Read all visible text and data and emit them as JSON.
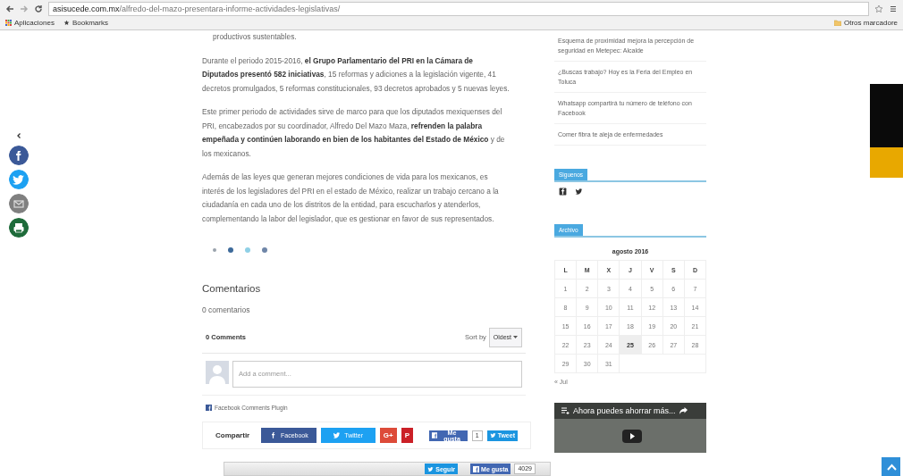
{
  "browser": {
    "url_host": "asisucede.com.mx",
    "url_path": "/alfredo-del-mazo-presentara-informe-actividades-legislativas/",
    "bookmarks": [
      {
        "kind": "apps",
        "label": "Aplicaciones"
      },
      {
        "kind": "star",
        "label": "Bookmarks"
      }
    ],
    "other_bookmarks": "Otros marcadore"
  },
  "share_rail": {
    "items": [
      {
        "kind": "facebook"
      },
      {
        "kind": "twitter"
      },
      {
        "kind": "email"
      },
      {
        "kind": "print"
      }
    ]
  },
  "article": {
    "paragraphs": [
      "productivos sustentables.",
      "Durante el periodo 2015-2016, **el Grupo Parlamentario del PRI en la Cámara de Diputados presentó 582 iniciativas**, 15 reformas y adiciones a la legislación vigente, 41 decretos promulgados, 5 reformas constitucionales, 93 decretos aprobados y 5 nuevas leyes.",
      "Este primer periodo de actividades sirve de marco para que los diputados mexiquenses del PRI, encabezados por su coordinador, Alfredo Del Mazo Maza, **refrenden la palabra empeñada y continúen laborando en bien de los habitantes del Estado de México** y de los mexicanos.",
      "Además de las leyes que generan mejores condiciones de vida para los mexicanos, es interés de los legisladores del PRI en el estado de México, realizar un trabajo cercano a la ciudadanía en cada uno de los distritos de la entidad, para escucharlos y atenderlos, complementando la labor del legislador, que es gestionar en favor de sus representados."
    ],
    "dots": [
      {
        "color": "#9aa3ad"
      },
      {
        "color": "#3d6a9a"
      },
      {
        "color": "#8fd0e6"
      },
      {
        "color": "#6f86a8"
      }
    ],
    "comments_heading": "Comentarios",
    "comments_count": "0 comentarios",
    "fb_comments": {
      "count_label": "0 Comments",
      "sort_label": "Sort by",
      "sort_value": "Oldest",
      "placeholder": "Add a comment...",
      "plugin_label": "Facebook Comments Plugin"
    },
    "share": {
      "label": "Compartir",
      "buttons": [
        {
          "kind": "facebook",
          "label": "Facebook"
        },
        {
          "kind": "twitter",
          "label": "Twitter"
        },
        {
          "kind": "gplus",
          "label": "G+"
        },
        {
          "kind": "pinterest",
          "label": "P"
        }
      ],
      "like_label": "Me gusta",
      "like_count": "1",
      "tweet_label": "Tweet"
    }
  },
  "sidebar": {
    "recent_posts": [
      "Esquema de proximidad mejora la percepción de seguridad en Metepec: Alcalde",
      "¿Buscas trabajo? Hoy es la Feria del Empleo en Toluca",
      "Whatsapp compartirá tu número de teléfono con Facebook",
      "Comer fibra te aleja de enfermedades"
    ],
    "follow": {
      "title": "Siguenos",
      "icons": [
        {
          "kind": "facebook"
        },
        {
          "kind": "twitter"
        }
      ]
    },
    "archive": {
      "title": "Archivo",
      "caption": "agosto 2016",
      "weekdays": [
        "L",
        "M",
        "X",
        "J",
        "V",
        "S",
        "D"
      ],
      "weeks": [
        [
          {
            "day": "1",
            "selected": false
          },
          {
            "day": "2",
            "selected": false
          },
          {
            "day": "3",
            "selected": false
          },
          {
            "day": "4",
            "selected": false
          },
          {
            "day": "5",
            "selected": false
          },
          {
            "day": "6",
            "selected": false
          },
          {
            "day": "7",
            "selected": false
          }
        ],
        [
          {
            "day": "8",
            "selected": false
          },
          {
            "day": "9",
            "selected": false
          },
          {
            "day": "10",
            "selected": false
          },
          {
            "day": "11",
            "selected": false
          },
          {
            "day": "12",
            "selected": false
          },
          {
            "day": "13",
            "selected": false
          },
          {
            "day": "14",
            "selected": false
          }
        ],
        [
          {
            "day": "15",
            "selected": false
          },
          {
            "day": "16",
            "selected": false
          },
          {
            "day": "17",
            "selected": false
          },
          {
            "day": "18",
            "selected": false
          },
          {
            "day": "19",
            "selected": false
          },
          {
            "day": "20",
            "selected": false
          },
          {
            "day": "21",
            "selected": false
          }
        ],
        [
          {
            "day": "22",
            "selected": false
          },
          {
            "day": "23",
            "selected": false
          },
          {
            "day": "24",
            "selected": false
          },
          {
            "day": "25",
            "selected": true
          },
          {
            "day": "26",
            "selected": false
          },
          {
            "day": "27",
            "selected": false
          },
          {
            "day": "28",
            "selected": false
          }
        ],
        [
          {
            "day": "29",
            "selected": false
          },
          {
            "day": "30",
            "selected": false
          },
          {
            "day": "31",
            "selected": false
          }
        ]
      ],
      "prev_link": "« Jul"
    },
    "video": {
      "title": "Ahora puedes ahorrar más..."
    }
  },
  "bottom_bar": {
    "follow_label": "Seguir",
    "like_label": "Me gusta",
    "like_count": "4029"
  }
}
